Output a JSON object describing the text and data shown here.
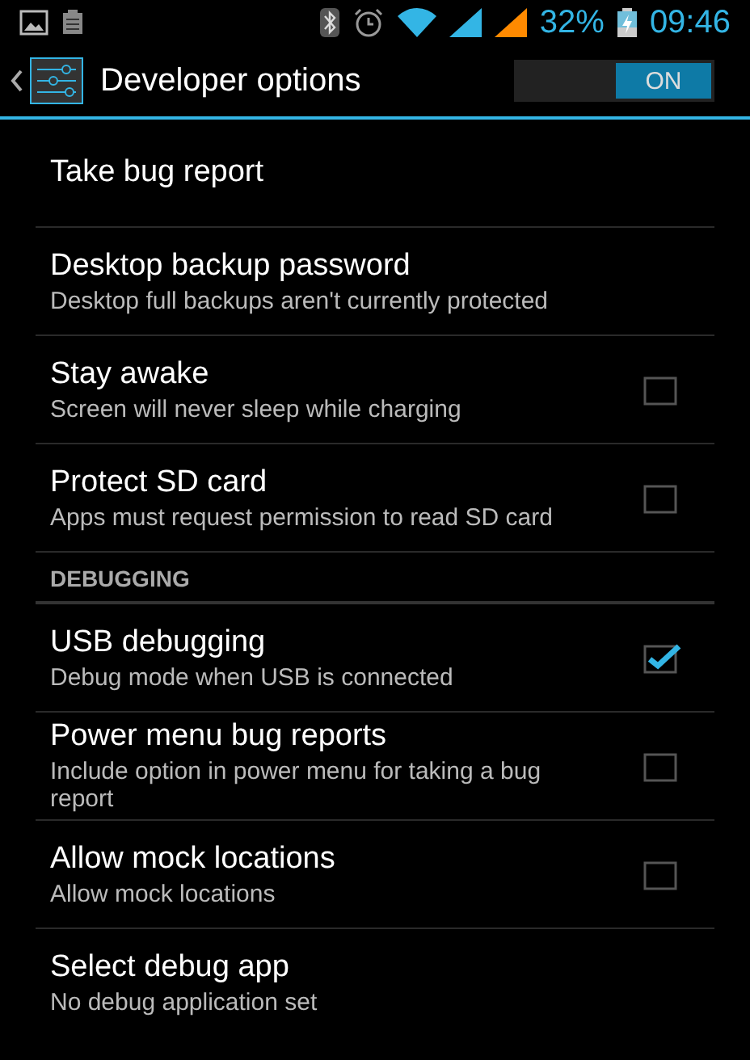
{
  "status_bar": {
    "battery": "32%",
    "time": "09:46"
  },
  "action_bar": {
    "title": "Developer options",
    "switch": {
      "label": "ON",
      "on": true
    }
  },
  "items": [
    {
      "kind": "item",
      "title": "Take bug report"
    },
    {
      "kind": "item",
      "title": "Desktop backup password",
      "summary": "Desktop full backups aren't currently protected"
    },
    {
      "kind": "item",
      "title": "Stay awake",
      "summary": "Screen will never sleep while charging",
      "checked": false
    },
    {
      "kind": "item",
      "title": "Protect SD card",
      "summary": "Apps must request permission to read SD card",
      "checked": false
    },
    {
      "kind": "header",
      "title": "DEBUGGING"
    },
    {
      "kind": "item",
      "title": "USB debugging",
      "summary": "Debug mode when USB is connected",
      "checked": true
    },
    {
      "kind": "item",
      "title": "Power menu bug reports",
      "summary": "Include option in power menu for taking a bug report",
      "checked": false
    },
    {
      "kind": "item",
      "title": "Allow mock locations",
      "summary": "Allow mock locations",
      "checked": false
    },
    {
      "kind": "item",
      "title": "Select debug app",
      "summary": "No debug application set"
    }
  ]
}
